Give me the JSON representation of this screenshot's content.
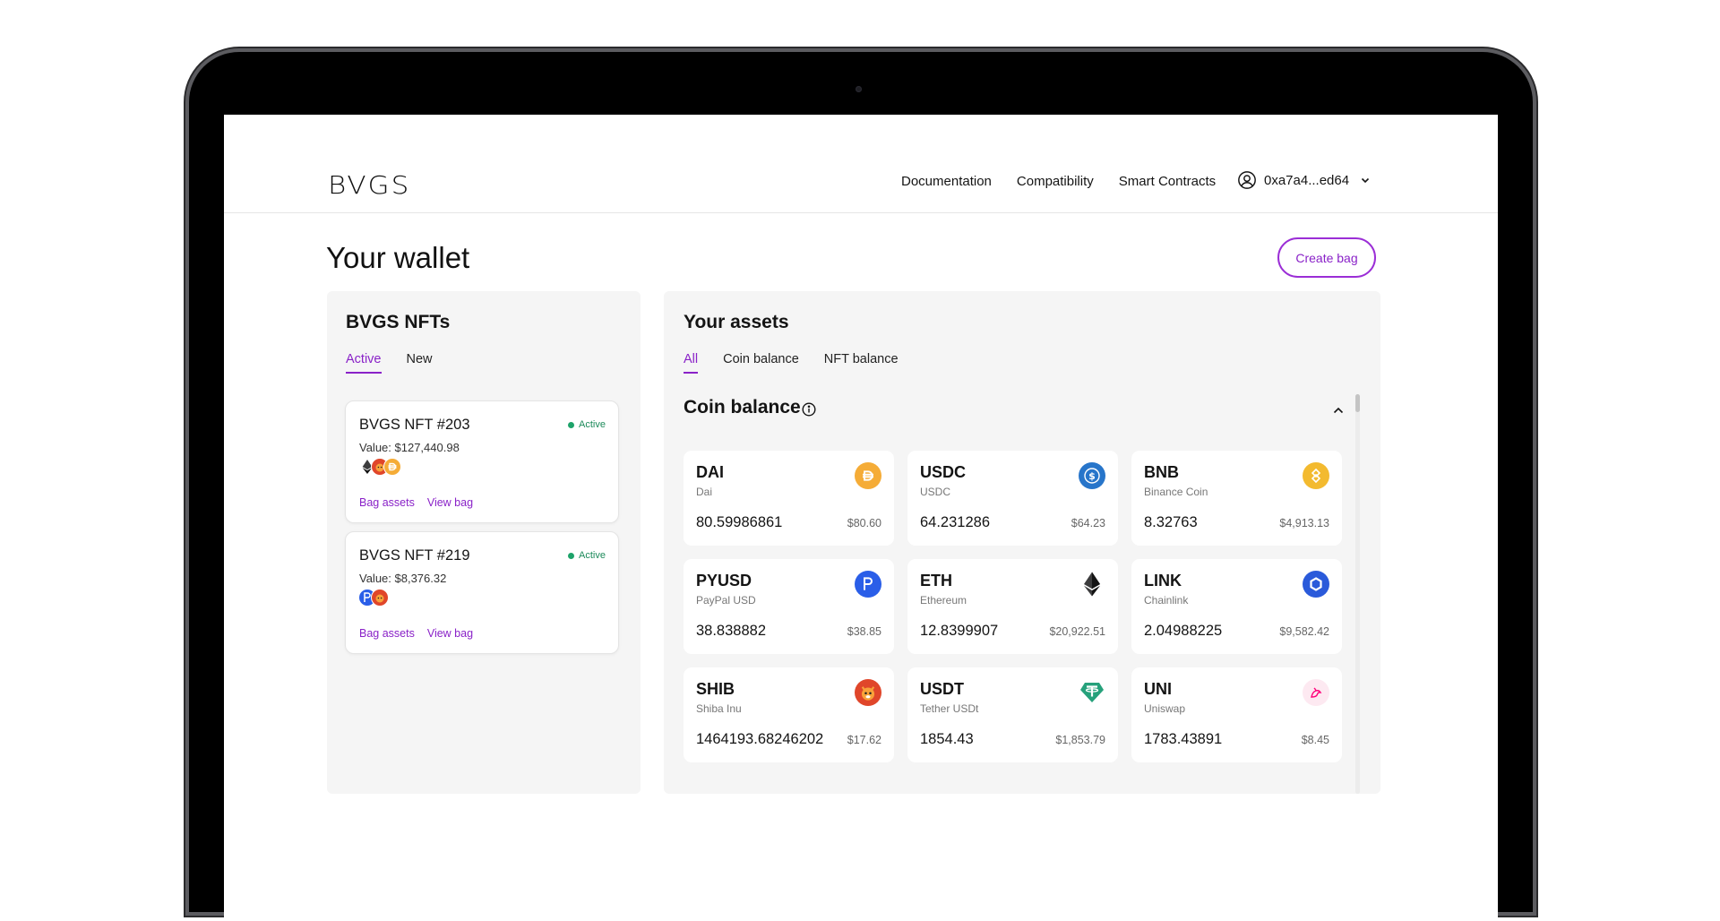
{
  "colors": {
    "accent": "#8a22c8",
    "status_active": "#1ea36a",
    "panel_bg": "#f5f5f5"
  },
  "header": {
    "logo": "BVGS",
    "nav": [
      "Documentation",
      "Compatibility",
      "Smart Contracts"
    ],
    "account": {
      "address": "0xa7a4...ed64",
      "icon": "user-circle-icon"
    }
  },
  "page": {
    "title": "Your wallet",
    "create_bag_label": "Create bag"
  },
  "nfts_panel": {
    "title": "BVGS NFTs",
    "tabs": [
      {
        "label": "Active",
        "active": true
      },
      {
        "label": "New",
        "active": false
      }
    ],
    "cards": [
      {
        "title": "BVGS NFT #203",
        "status": "Active",
        "value": "Value: $127,440.98",
        "coins": [
          "ETH",
          "SHIB",
          "DAI"
        ],
        "link_assets": "Bag assets",
        "link_view": "View bag"
      },
      {
        "title": "BVGS NFT #219",
        "status": "Active",
        "value": "Value: $8,376.32",
        "coins": [
          "PYUSD",
          "SHIB"
        ],
        "link_assets": "Bag assets",
        "link_view": "View bag"
      }
    ]
  },
  "assets_panel": {
    "title": "Your assets",
    "tabs": [
      {
        "label": "All",
        "active": true
      },
      {
        "label": "Coin balance",
        "active": false
      },
      {
        "label": "NFT balance",
        "active": false
      }
    ],
    "section_title": "Coin balance",
    "coins": [
      {
        "symbol": "DAI",
        "name": "Dai",
        "amount": "80.59986861",
        "usd": "$80.60",
        "icon": "dai-icon"
      },
      {
        "symbol": "USDC",
        "name": "USDC",
        "amount": "64.231286",
        "usd": "$64.23",
        "icon": "usdc-icon"
      },
      {
        "symbol": "BNB",
        "name": "Binance Coin",
        "amount": "8.32763",
        "usd": "$4,913.13",
        "icon": "bnb-icon"
      },
      {
        "symbol": "PYUSD",
        "name": "PayPal USD",
        "amount": "38.838882",
        "usd": "$38.85",
        "icon": "pyusd-icon"
      },
      {
        "symbol": "ETH",
        "name": "Ethereum",
        "amount": "12.8399907",
        "usd": "$20,922.51",
        "icon": "eth-icon"
      },
      {
        "symbol": "LINK",
        "name": "Chainlink",
        "amount": "2.04988225",
        "usd": "$9,582.42",
        "icon": "link-icon"
      },
      {
        "symbol": "SHIB",
        "name": "Shiba Inu",
        "amount": "1464193.68246202",
        "usd": "$17.62",
        "icon": "shib-icon"
      },
      {
        "symbol": "USDT",
        "name": "Tether USDt",
        "amount": "1854.43",
        "usd": "$1,853.79",
        "icon": "usdt-icon"
      },
      {
        "symbol": "UNI",
        "name": "Uniswap",
        "amount": "1783.43891",
        "usd": "$8.45",
        "icon": "uni-icon"
      }
    ]
  }
}
